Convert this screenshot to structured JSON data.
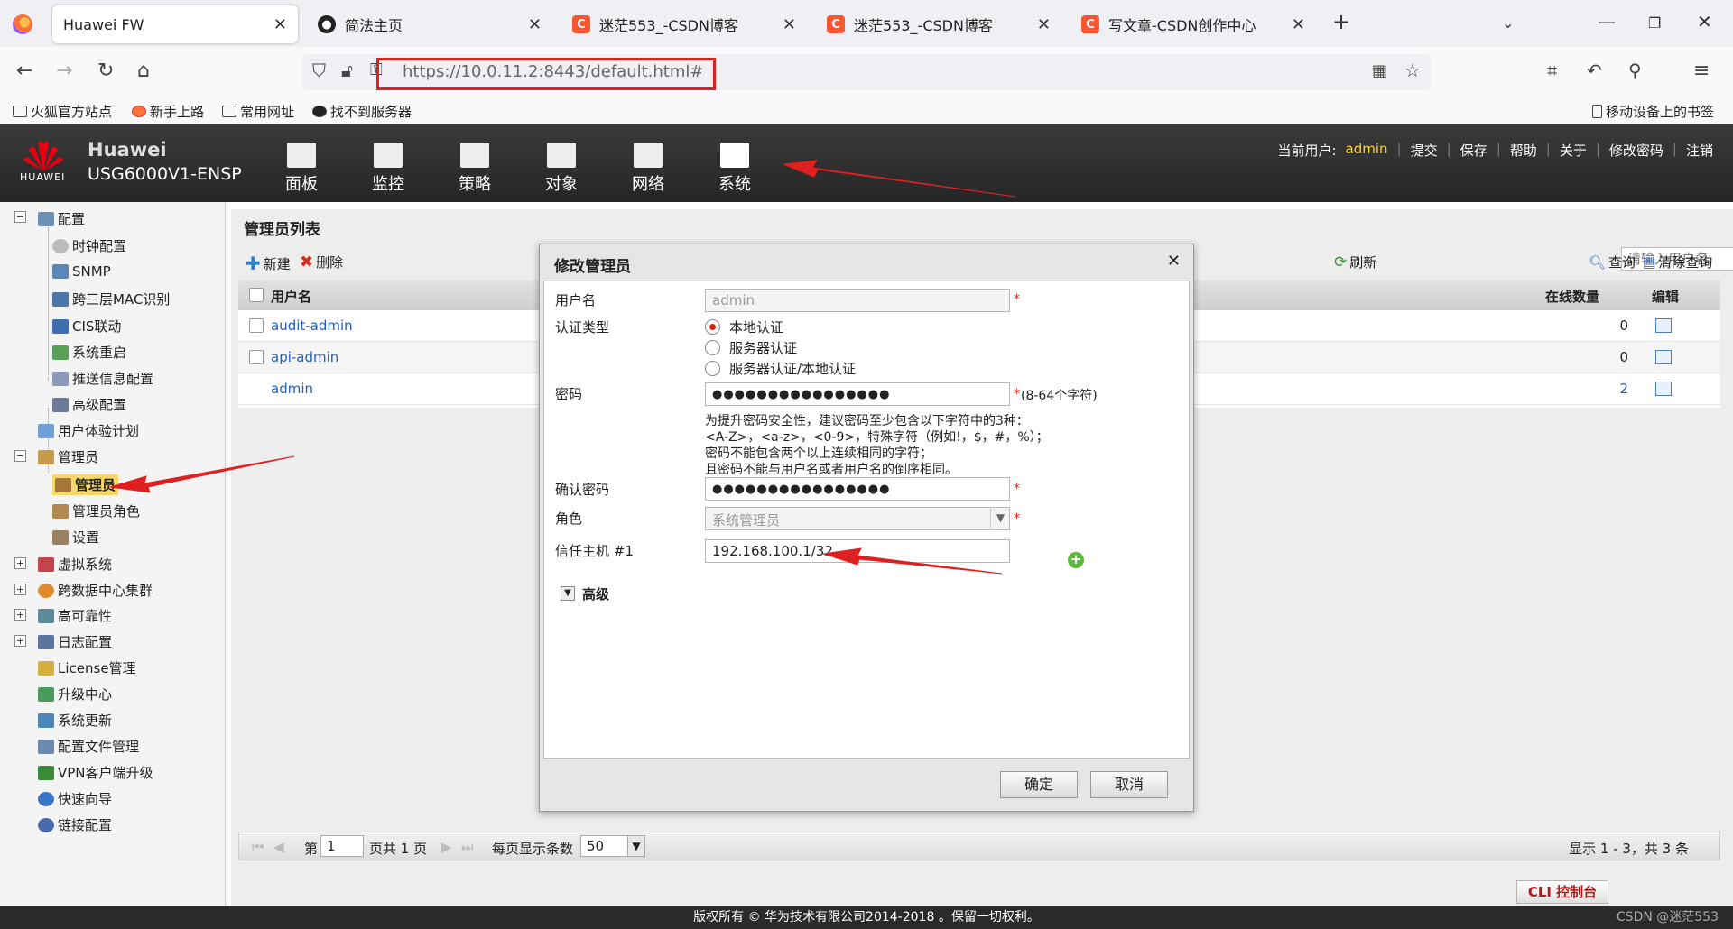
{
  "browser": {
    "tabs": [
      {
        "title": "Huawei FW"
      },
      {
        "title": "简法主页"
      },
      {
        "title": "迷茫553_-CSDN博客"
      },
      {
        "title": "迷茫553_-CSDN博客"
      },
      {
        "title": "写文章-CSDN创作中心"
      }
    ],
    "url_host": "https://10.0.11.2",
    "url_rest": ":8443/default.html#",
    "bookmarks": [
      "火狐官方站点",
      "新手上路",
      "常用网址",
      "找不到服务器"
    ],
    "mobile_bookmarks": "移动设备上的书签"
  },
  "header": {
    "brand": "Huawei",
    "model": "USG6000V1-ENSP",
    "logo_text": "HUAWEI",
    "menus": [
      "面板",
      "监控",
      "策略",
      "对象",
      "网络",
      "系统"
    ],
    "current_user_label": "当前用户:",
    "current_user": "admin",
    "actions": [
      "提交",
      "保存",
      "帮助",
      "关于",
      "修改密码",
      "注销"
    ]
  },
  "sidebar": {
    "items": [
      {
        "label": "配置"
      },
      {
        "label": "时钟配置"
      },
      {
        "label": "SNMP"
      },
      {
        "label": "跨三层MAC识别"
      },
      {
        "label": "CIS联动"
      },
      {
        "label": "系统重启"
      },
      {
        "label": "推送信息配置"
      },
      {
        "label": "高级配置"
      },
      {
        "label": "用户体验计划"
      },
      {
        "label": "管理员"
      },
      {
        "label": "管理员"
      },
      {
        "label": "管理员角色"
      },
      {
        "label": "设置"
      },
      {
        "label": "虚拟系统"
      },
      {
        "label": "跨数据中心集群"
      },
      {
        "label": "高可靠性"
      },
      {
        "label": "日志配置"
      },
      {
        "label": "License管理"
      },
      {
        "label": "升级中心"
      },
      {
        "label": "系统更新"
      },
      {
        "label": "配置文件管理"
      },
      {
        "label": "VPN客户端升级"
      },
      {
        "label": "快速向导"
      },
      {
        "label": "链接配置"
      }
    ]
  },
  "panel": {
    "title": "管理员列表",
    "new_label": "新建",
    "delete_label": "删除",
    "refresh_label": "刷新",
    "search_placeholder": "请输入用户名",
    "query_label": "查询",
    "clear_label": "清除查询",
    "columns": {
      "username": "用户名",
      "online": "在线数量",
      "edit": "编辑"
    },
    "rows": [
      {
        "username": "audit-admin",
        "online": "0"
      },
      {
        "username": "api-admin",
        "online": "0"
      },
      {
        "username": "admin",
        "online": "2"
      }
    ]
  },
  "pager": {
    "page_prefix": "第",
    "page": "1",
    "page_suffix": "页共 1 页",
    "per_page_label": "每页显示条数",
    "per_page": "50",
    "summary": "显示 1 - 3，共 3 条"
  },
  "dialog": {
    "title": "修改管理员",
    "username_label": "用户名",
    "username_value": "admin",
    "auth_label": "认证类型",
    "auth_options": [
      "本地认证",
      "服务器认证",
      "服务器认证/本地认证"
    ],
    "password_label": "密码",
    "password_mask": "●●●●●●●●●●●●●●●●",
    "password_hint_req": "(8-64个字符)",
    "hint_lines": [
      "为提升密码安全性，建议密码至少包含以下字符中的3种：",
      "<A-Z>，<a-z>，<0-9>，特殊字符（例如!，$，#，%）；",
      "密码不能包含两个以上连续相同的字符；",
      "且密码不能与用户名或者用户名的倒序相同。"
    ],
    "confirm_label": "确认密码",
    "confirm_mask": "●●●●●●●●●●●●●●●●",
    "role_label": "角色",
    "role_value": "系统管理员",
    "trust_label": "信任主机 #1",
    "trust_value": "192.168.100.1/32",
    "advanced_label": "高级",
    "ok_label": "确定",
    "cancel_label": "取消"
  },
  "cli_label": "CLI 控制台",
  "footer": "版权所有 © 华为技术有限公司2014-2018 。保留一切权利。",
  "watermark": "CSDN @迷茫553",
  "colors": {
    "accent_red": "#e02020",
    "user_yellow": "#ffd21f",
    "link_blue": "#1f5fbf"
  }
}
